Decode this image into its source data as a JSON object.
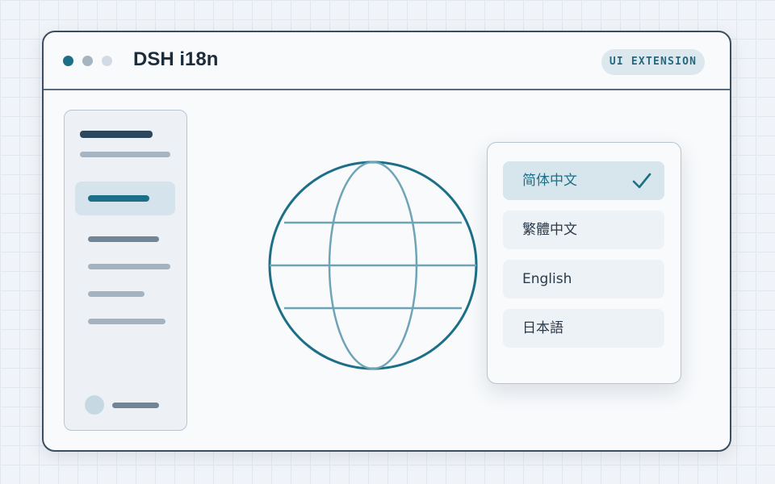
{
  "window": {
    "title": "DSH i18n",
    "badge": "UI EXTENSION"
  },
  "language_menu": {
    "items": [
      {
        "label": "简体中文",
        "selected": true
      },
      {
        "label": "繁體中文",
        "selected": false
      },
      {
        "label": "English",
        "selected": false
      },
      {
        "label": "日本語",
        "selected": false
      }
    ]
  },
  "icons": {
    "traffic_lights": [
      "window-dot-primary-icon",
      "window-dot-secondary-icon",
      "window-dot-tertiary-icon"
    ],
    "main": "globe-icon",
    "selection": "checkmark-icon"
  },
  "colors": {
    "accent": "#1c6f86",
    "frame": "#3c4d5f",
    "background": "#f0f3f7",
    "selected_item": "#d7e5ed",
    "badge_bg": "#dde7ee"
  }
}
